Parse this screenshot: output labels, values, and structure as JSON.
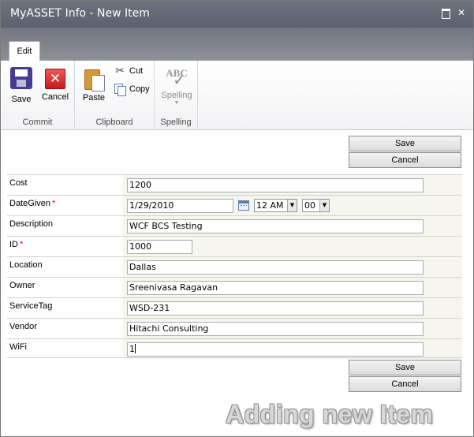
{
  "window": {
    "title": "MyASSET Info - New Item"
  },
  "ribbon": {
    "tab": "Edit",
    "groups": {
      "commit": "Commit",
      "clipboard": "Clipboard",
      "spelling": "Spelling"
    },
    "buttons": {
      "save": "Save",
      "cancel": "Cancel",
      "paste": "Paste",
      "cut": "Cut",
      "copy": "Copy",
      "spelling": "Spelling",
      "spelling_icon_text": "ABC"
    }
  },
  "form": {
    "save_label": "Save",
    "cancel_label": "Cancel",
    "required_mark": "*",
    "fields": {
      "cost": {
        "label": "Cost",
        "value": "1200"
      },
      "dategiven": {
        "label": "DateGiven",
        "value": "1/29/2010",
        "hour": "12 AM",
        "minute": "00"
      },
      "description": {
        "label": "Description",
        "value": "WCF BCS Testing"
      },
      "id": {
        "label": "ID",
        "value": "1000"
      },
      "location": {
        "label": "Location",
        "value": "Dallas"
      },
      "owner": {
        "label": "Owner",
        "value": "Sreenivasa Ragavan"
      },
      "servicetag": {
        "label": "ServiceTag",
        "value": "WSD-231"
      },
      "vendor": {
        "label": "Vendor",
        "value": "Hitachi Consulting"
      },
      "wifi": {
        "label": "WiFi",
        "value": "1"
      }
    }
  },
  "caption": "Adding new Item",
  "colors": {
    "titlebar": "#5b606c",
    "required": "#dd0000",
    "cancel_icon": "#c51c1c",
    "save_icon": "#453c96"
  },
  "icons": [
    "save-icon",
    "cancel-icon",
    "paste-icon",
    "cut-icon",
    "copy-icon",
    "spelling-icon",
    "calendar-icon",
    "maximize-icon",
    "close-icon"
  ]
}
